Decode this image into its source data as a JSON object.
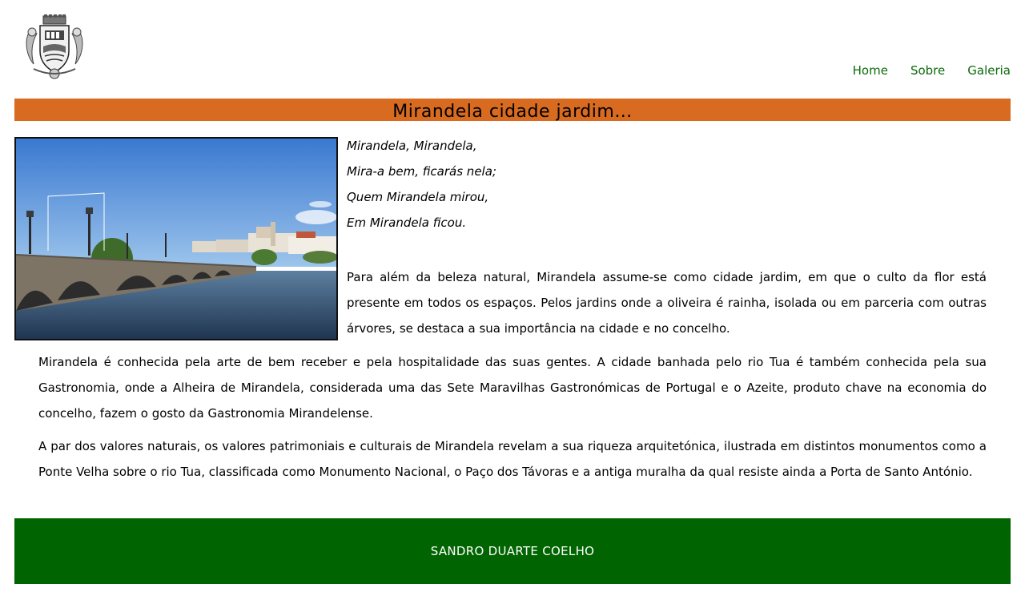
{
  "header": {
    "logo_icon": "coat-of-arms-icon",
    "nav": [
      {
        "label": "Home"
      },
      {
        "label": "Sobre"
      },
      {
        "label": "Galeria"
      }
    ]
  },
  "main": {
    "title": "Mirandela cidade jardim…",
    "photo_icon": "bridge-photo",
    "poem": [
      "Mirandela, Mirandela,",
      "Mira-a bem, ficarás nela;",
      "Quem Mirandela mirou,",
      "Em Mirandela ficou."
    ],
    "paragraphs": [
      "Para além da beleza natural, Mirandela assume-se como cidade jardim, em que o culto da flor está presente em todos os espaços. Pelos jardins onde a oliveira é rainha, isolada ou em parceria com outras árvores, se destaca a sua importância na cidade e no concelho.",
      "Mirandela é conhecida pela arte de bem receber e pela hospitalidade das suas gentes. A cidade banhada pelo rio Tua é também conhecida pela sua Gastronomia, onde a Alheira de Mirandela, considerada uma das Sete Maravilhas Gastronómicas de Portugal e o Azeite, produto chave na economia do concelho, fazem o gosto da Gastronomia Mirandelense.",
      "A par dos valores naturais, os valores patrimoniais e culturais de Mirandela revelam a sua riqueza arquitetónica, ilustrada em distintos monumentos como a Ponte Velha sobre o rio Tua, classificada como Monumento Nacional, o Paço dos Távoras e a antiga muralha da qual resiste ainda a Porta de Santo António."
    ]
  },
  "footer": {
    "text": "SANDRO DUARTE COELHO"
  },
  "colors": {
    "accent_orange": "#d96b20",
    "footer_green": "#006400",
    "nav_green": "#0b6b0b"
  }
}
